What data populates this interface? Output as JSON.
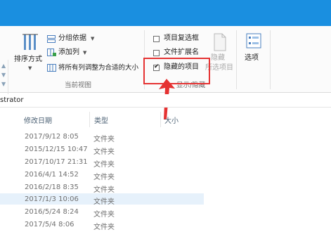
{
  "ribbon": {
    "sort_by": "排序方式",
    "group_by": "分组依据",
    "add_columns": "添加列",
    "size_all_columns": "将所有列调整为合适的大小",
    "current_view_label": "当前视图",
    "item_checkboxes": "项目复选框",
    "file_extensions": "文件扩展名",
    "hidden_items": "隐藏的项目",
    "hide_selected_line1": "隐藏",
    "hide_selected_line2": "所选项目",
    "show_hide_label": "显示/隐藏",
    "options": "选项"
  },
  "address": {
    "path_fragment": "strator"
  },
  "columns": {
    "date_modified": "修改日期",
    "type": "类型",
    "size": "大小"
  },
  "rows": [
    {
      "date": "2017/9/12 8:05",
      "type": "文件夹"
    },
    {
      "date": "2015/12/15 10:47",
      "type": "文件夹"
    },
    {
      "date": "2017/10/17 21:31",
      "type": "文件夹"
    },
    {
      "date": "2016/4/1 14:52",
      "type": "文件夹"
    },
    {
      "date": "2016/2/18 8:35",
      "type": "文件夹"
    },
    {
      "date": "2017/1/3 10:06",
      "type": "文件夹"
    },
    {
      "date": "2016/5/24 8:24",
      "type": "文件夹"
    },
    {
      "date": "2017/5/4 8:06",
      "type": "文件夹"
    }
  ],
  "colors": {
    "title_bar": "#1a8fe0",
    "highlight": "#e53232",
    "selected_row": "#e6f1fb"
  }
}
